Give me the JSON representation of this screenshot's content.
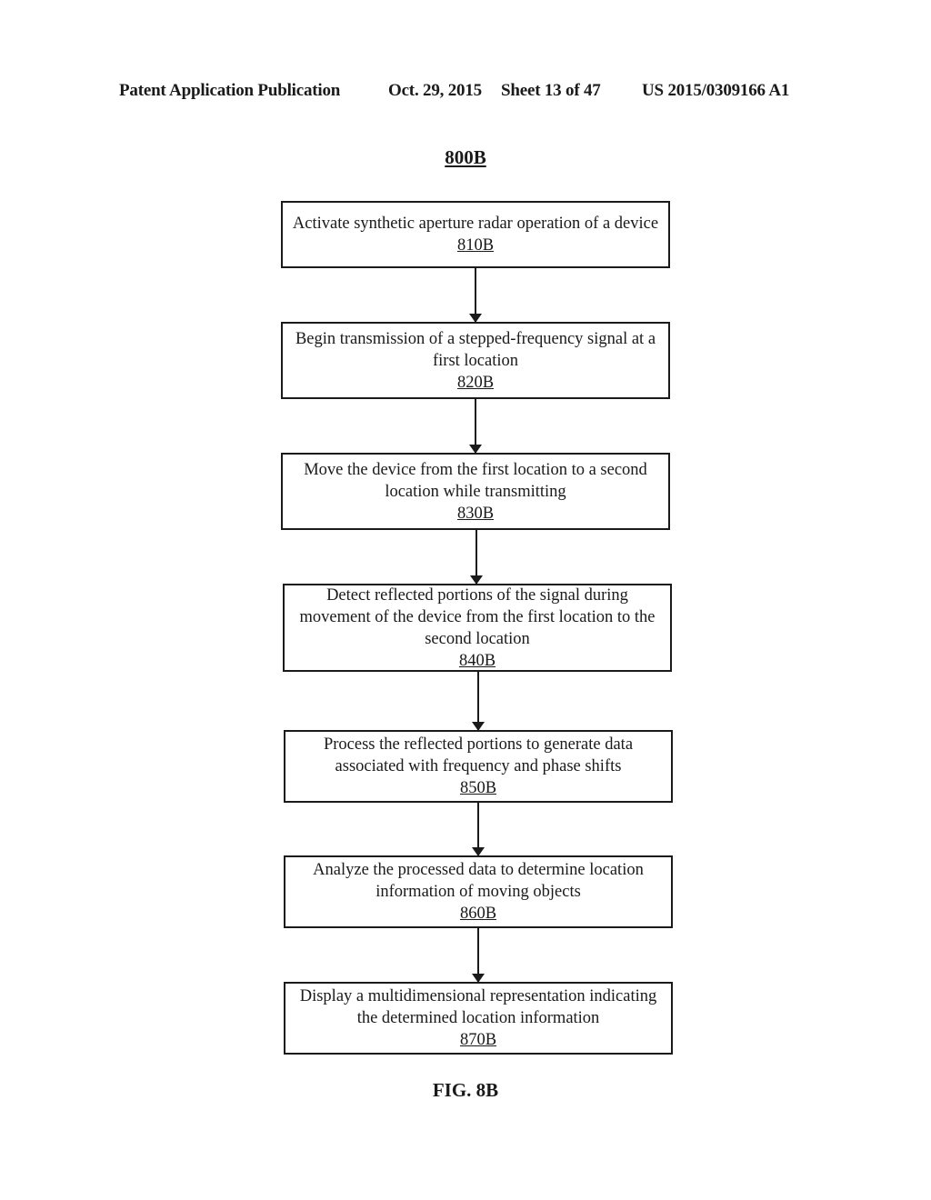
{
  "header": {
    "left": "Patent Application Publication",
    "date": "Oct. 29, 2015",
    "sheet": "Sheet 13 of 47",
    "publication_number": "US 2015/0309166 A1"
  },
  "figure_id": "800B",
  "steps": [
    {
      "text": "Activate synthetic aperture radar operation of a device",
      "ref": "810B"
    },
    {
      "text": "Begin transmission of a stepped-frequency signal at a first location",
      "ref": "820B"
    },
    {
      "text": "Move the device from the first location to a second location while transmitting",
      "ref": "830B"
    },
    {
      "text": "Detect reflected portions of the signal during movement of the device from the first location to the second location",
      "ref": "840B"
    },
    {
      "text": "Process the reflected portions to generate data associated with frequency and phase shifts",
      "ref": "850B"
    },
    {
      "text": "Analyze the processed data to determine location information of moving objects",
      "ref": "860B"
    },
    {
      "text": "Display a multidimensional representation indicating the determined location information",
      "ref": "870B"
    }
  ],
  "caption": "FIG. 8B"
}
